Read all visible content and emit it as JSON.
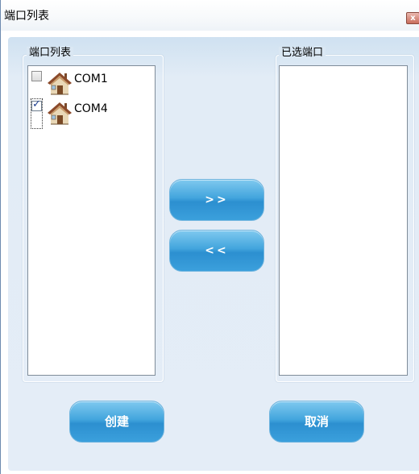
{
  "window": {
    "title": "端口列表",
    "close_glyph": "x"
  },
  "left_group": {
    "title": "端口列表",
    "items": [
      {
        "label": "COM1",
        "checked": false,
        "icon": "house-icon"
      },
      {
        "label": "COM4",
        "checked": true,
        "icon": "house-icon"
      }
    ]
  },
  "right_group": {
    "title": "已选端口",
    "items": []
  },
  "buttons": {
    "add": ">>",
    "remove": "<<",
    "create": "创建",
    "cancel": "取消"
  },
  "colors": {
    "accent_button": "#3ba0dc",
    "client_background": "#e4edf7",
    "check_mark": "#1f3f8f"
  }
}
